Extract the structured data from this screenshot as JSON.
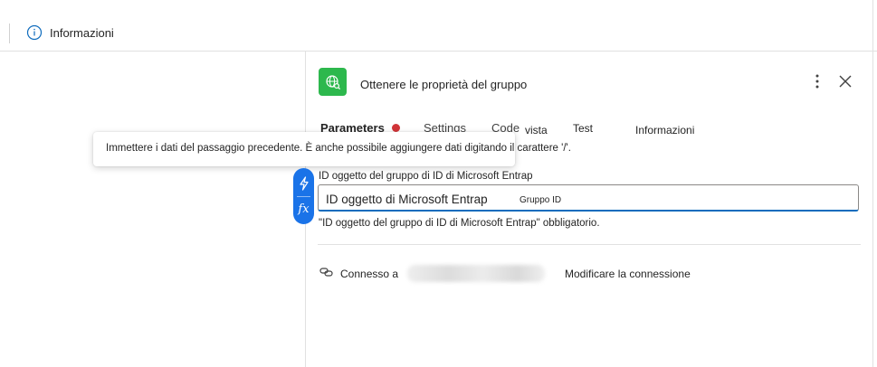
{
  "topbar": {
    "info_label": "Informazioni"
  },
  "panel": {
    "title": "Ottenere le proprietà del gruppo",
    "tabs": {
      "parameters": "Parameters",
      "settings": "Settings",
      "code": "Code",
      "vista": "vista",
      "test": "Test",
      "info": "Informazioni"
    }
  },
  "tooltip": {
    "text": "Immettere i dati del passaggio precedente. È anche possibile aggiungere dati digitando il carattere '/'."
  },
  "field": {
    "label": "ID oggetto del gruppo di ID di Microsoft Entrap",
    "value": "ID oggetto di Microsoft Entrap",
    "chip": "Gruppo ID",
    "required_message": "\"ID oggetto del gruppo di ID di Microsoft Entrap\" obbligatorio."
  },
  "dynamic": {
    "expression_label": "fx"
  },
  "connection": {
    "label": "Connesso a",
    "change_label": "Modificare la connessione"
  },
  "colors": {
    "accent": "#0f6cbd",
    "action_icon_bg": "#2db84d",
    "required_dot": "#d13438",
    "pill": "#1a73e8"
  },
  "icons": [
    "info-icon",
    "globe-search-icon",
    "more-vertical-icon",
    "close-icon",
    "lightning-icon",
    "fx-icon",
    "link-icon"
  ]
}
